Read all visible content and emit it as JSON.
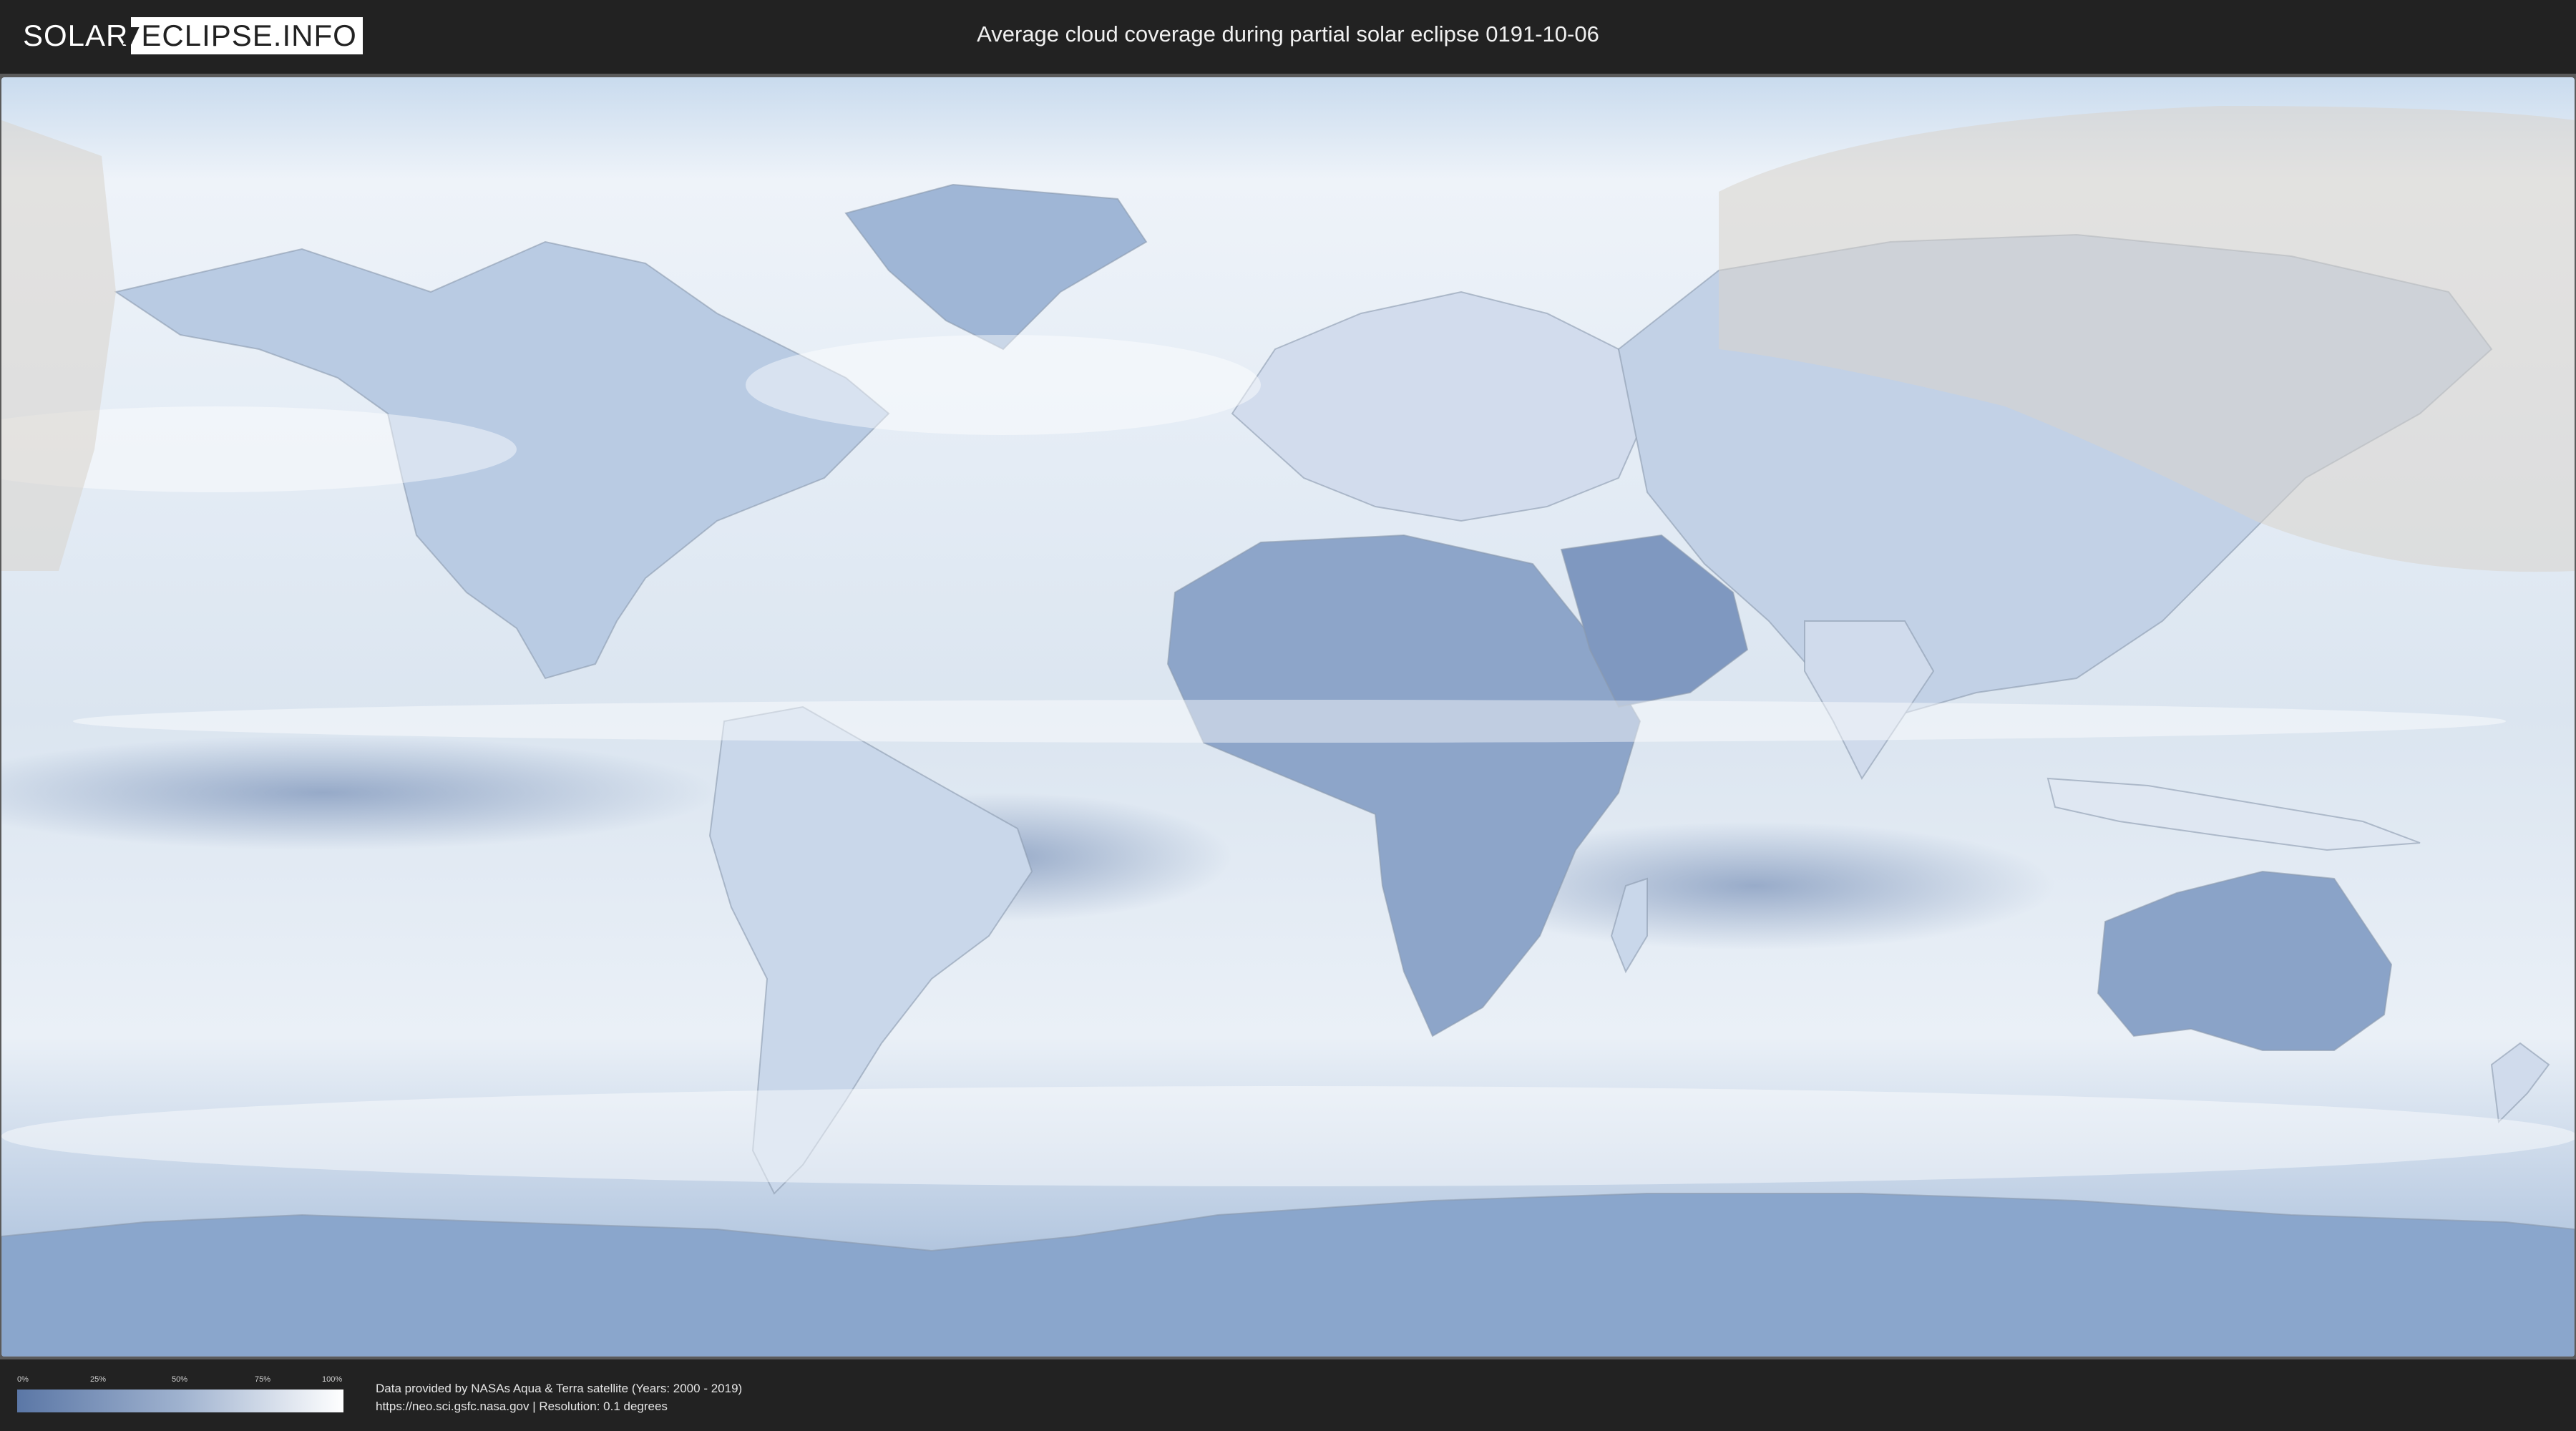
{
  "header": {
    "logo_left": "SOLAR",
    "logo_right": "ECLIPSE.INFO",
    "title": "Average cloud coverage during partial solar eclipse 0191-10-06"
  },
  "map": {
    "description_colors": {
      "ocean_clear": "#ffffff",
      "cloud_low": "#5b77a6",
      "eclipse_overlay": "#d9d4cc",
      "frame": "#5a5a5a"
    },
    "eclipse_visibility": "partial"
  },
  "legend": {
    "ticks": [
      "0%",
      "25%",
      "50%",
      "75%",
      "100%"
    ],
    "colors": {
      "start": "#5b77a6",
      "mid": "#9fb2cf",
      "end": "#ffffff"
    }
  },
  "footer": {
    "credit_line1": "Data provided by NASAs Aqua & Terra satellite (Years: 2000 - 2019)",
    "credit_line2": "https://neo.sci.gsfc.nasa.gov | Resolution: 0.1 degrees"
  }
}
